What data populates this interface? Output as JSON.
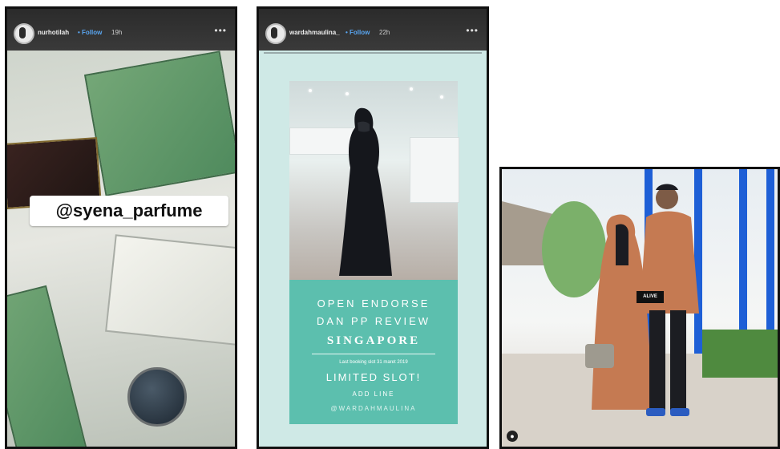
{
  "story1": {
    "username": "nurhotilah",
    "follow": "• Follow",
    "time": "19h",
    "more": "•••",
    "mention": "@syena_parfume"
  },
  "story2": {
    "username": "wardahmaulina_",
    "follow": "• Follow",
    "time": "22h",
    "more": "•••",
    "promo": {
      "line1": "OPEN ENDORSE",
      "line2": "DAN PP REVIEW",
      "line3": "SINGAPORE",
      "line4": "Last booking slot 31 maret 2019",
      "line5": "LIMITED SLOT!",
      "line6": "ADD LINE",
      "line7": "@WARDAHMAULINA"
    }
  },
  "post3": {
    "tag": "ALIVE",
    "icon": "person-icon"
  },
  "colors": {
    "follow_blue": "#5aa7f2",
    "promo_teal": "#5cbfae",
    "pillar_blue": "#1e5fd6",
    "outfit_tan": "#c57a52"
  }
}
